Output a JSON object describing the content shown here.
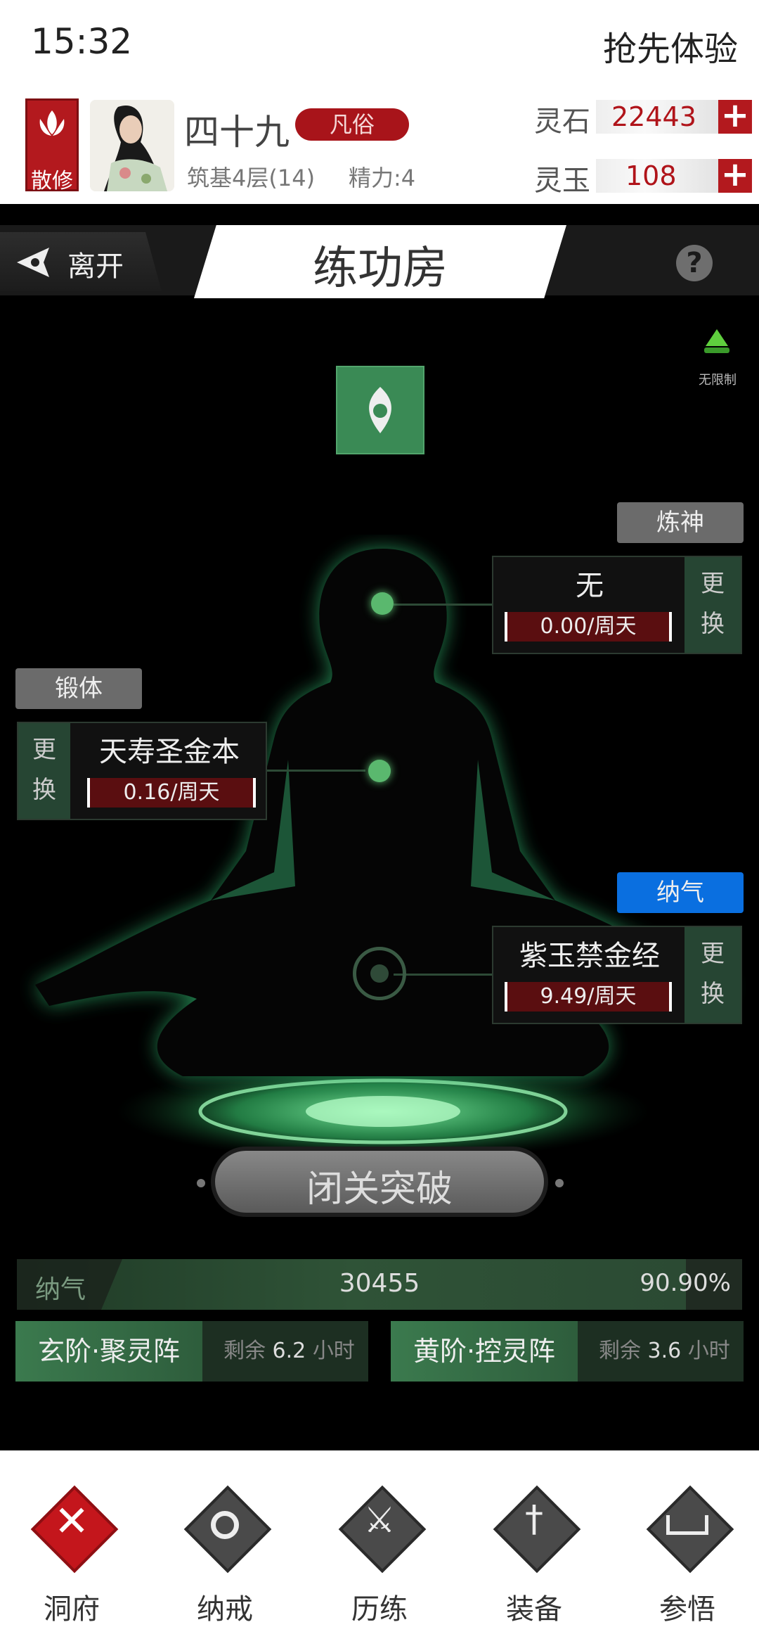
{
  "status": {
    "time": "15:32",
    "trial": "抢先体验"
  },
  "player": {
    "sect": "散修",
    "name": "四十九",
    "rank": "凡俗",
    "realm": "筑基4层(14)",
    "energy": "精力:4"
  },
  "currencies": [
    {
      "label": "灵石",
      "value": "22443"
    },
    {
      "label": "灵玉",
      "value": "108"
    }
  ],
  "nav": {
    "leave": "离开",
    "title": "练功房",
    "help": "?"
  },
  "unlimited": "无限制",
  "slots": {
    "spirit": {
      "tag": "炼神",
      "technique": "无",
      "rate": "0.00/周天",
      "change": [
        "更",
        "换"
      ]
    },
    "body": {
      "tag": "锻体",
      "technique": "天寿圣金本",
      "rate": "0.16/周天",
      "change": [
        "更",
        "换"
      ]
    },
    "qi": {
      "tag": "纳气",
      "technique": "紫玉禁金经",
      "rate": "9.49/周天",
      "change": [
        "更",
        "换"
      ]
    }
  },
  "breakthrough": "闭关突破",
  "qi_bar": {
    "label": "纳气",
    "value": "30455",
    "percent": "90.90%"
  },
  "formations": [
    {
      "name": "玄阶·聚灵阵",
      "remain_prefix": "剩余",
      "remain_value": "6.2",
      "remain_unit": "小时"
    },
    {
      "name": "黄阶·控灵阵",
      "remain_prefix": "剩余",
      "remain_value": "3.6",
      "remain_unit": "小时"
    }
  ],
  "bottom_nav": [
    "洞府",
    "纳戒",
    "历练",
    "装备",
    "参悟"
  ],
  "colors": {
    "accent_red": "#b3191e",
    "jade_green": "#3a8a55",
    "qi_blue": "#0a6fe0"
  }
}
